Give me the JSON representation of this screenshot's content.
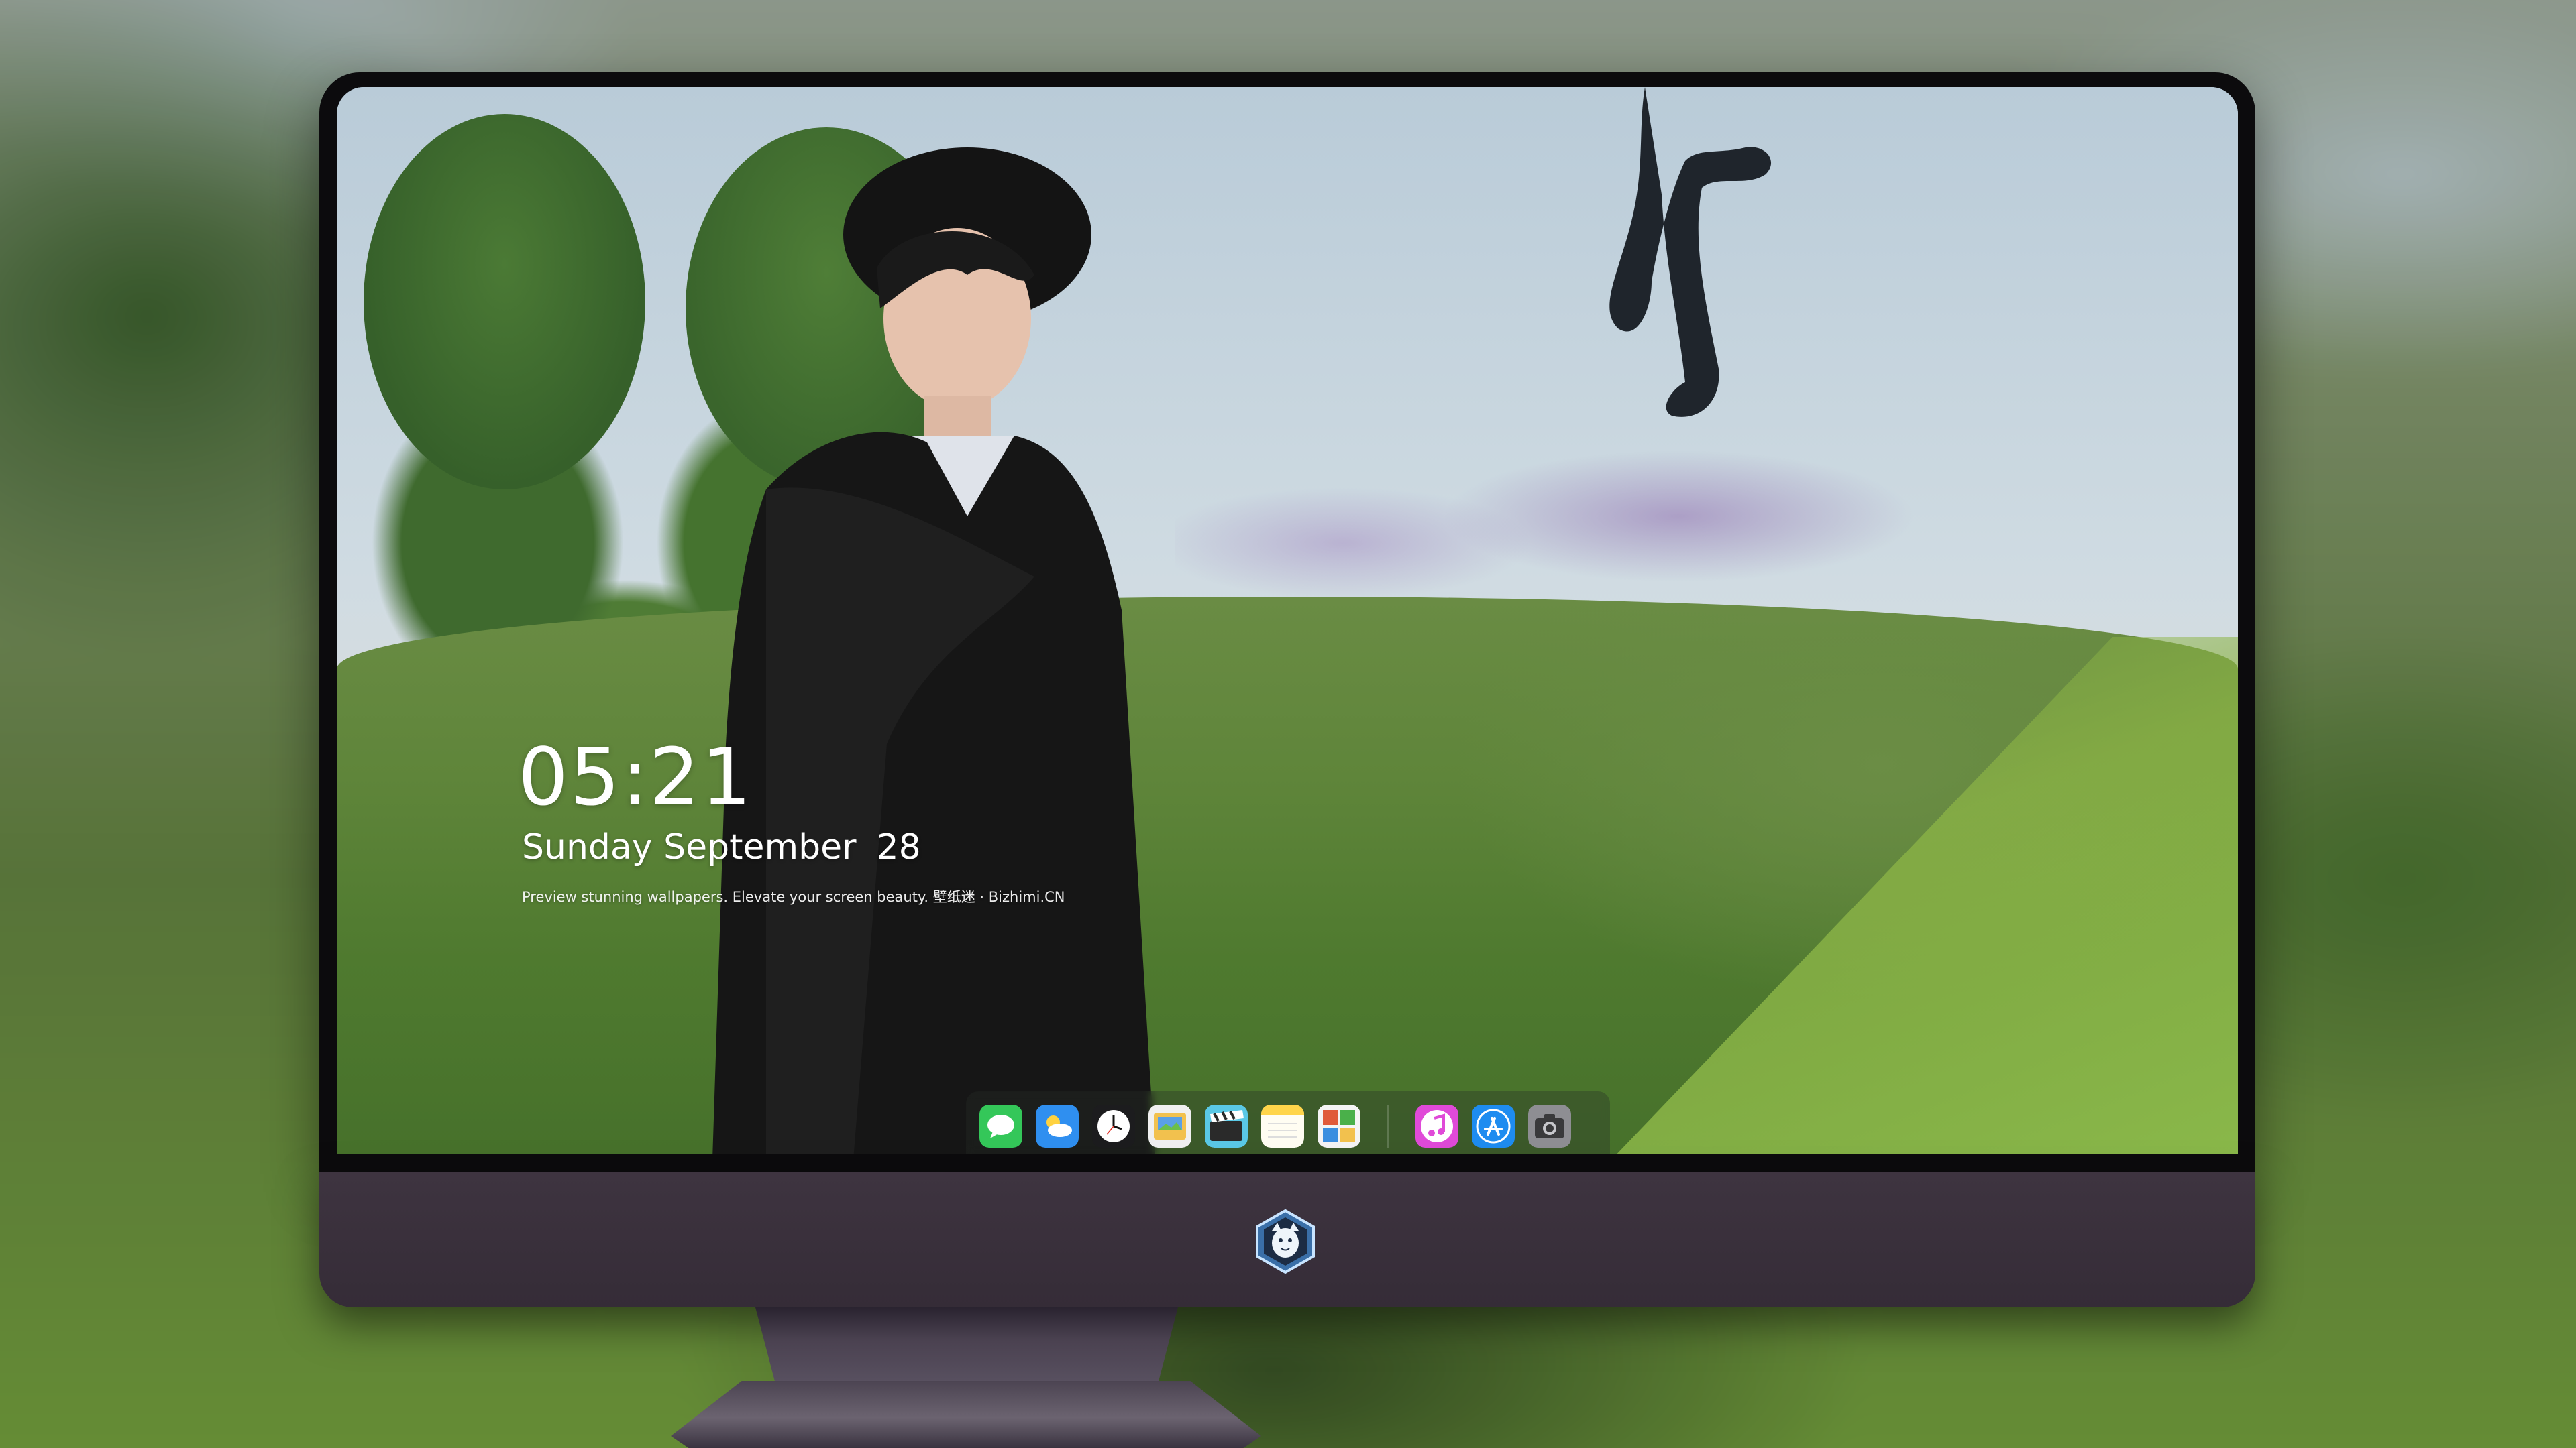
{
  "lock_screen": {
    "time": "05:21",
    "weekday_month": "Sunday September",
    "day": "28",
    "tagline": "Preview stunning wallpapers. Elevate your screen beauty. 壁纸迷 · Bizhimi.CN"
  },
  "dock": {
    "apps": [
      {
        "name": "messages-icon",
        "color": "#34c759"
      },
      {
        "name": "weather-icon",
        "color": "#2f8ff0"
      },
      {
        "name": "clock-icon",
        "color": "#ffffff"
      },
      {
        "name": "preview-icon",
        "color": "#f2c14e"
      },
      {
        "name": "clips-icon",
        "color": "#5ac8e6"
      },
      {
        "name": "notes-icon",
        "color": "#ffd54a"
      },
      {
        "name": "photo-booth-icon",
        "color": "#e05a3a"
      },
      {
        "name": "music-icon",
        "color": "#e04ad8"
      },
      {
        "name": "app-store-icon",
        "color": "#1e8cf0"
      },
      {
        "name": "camera-icon",
        "color": "#8e8e93"
      }
    ]
  },
  "monitor": {
    "logo": "dragon-mascot-logo"
  },
  "colors": {
    "bezel": "#0c0b0d",
    "chin": "#3e3440",
    "text": "#ffffff"
  }
}
